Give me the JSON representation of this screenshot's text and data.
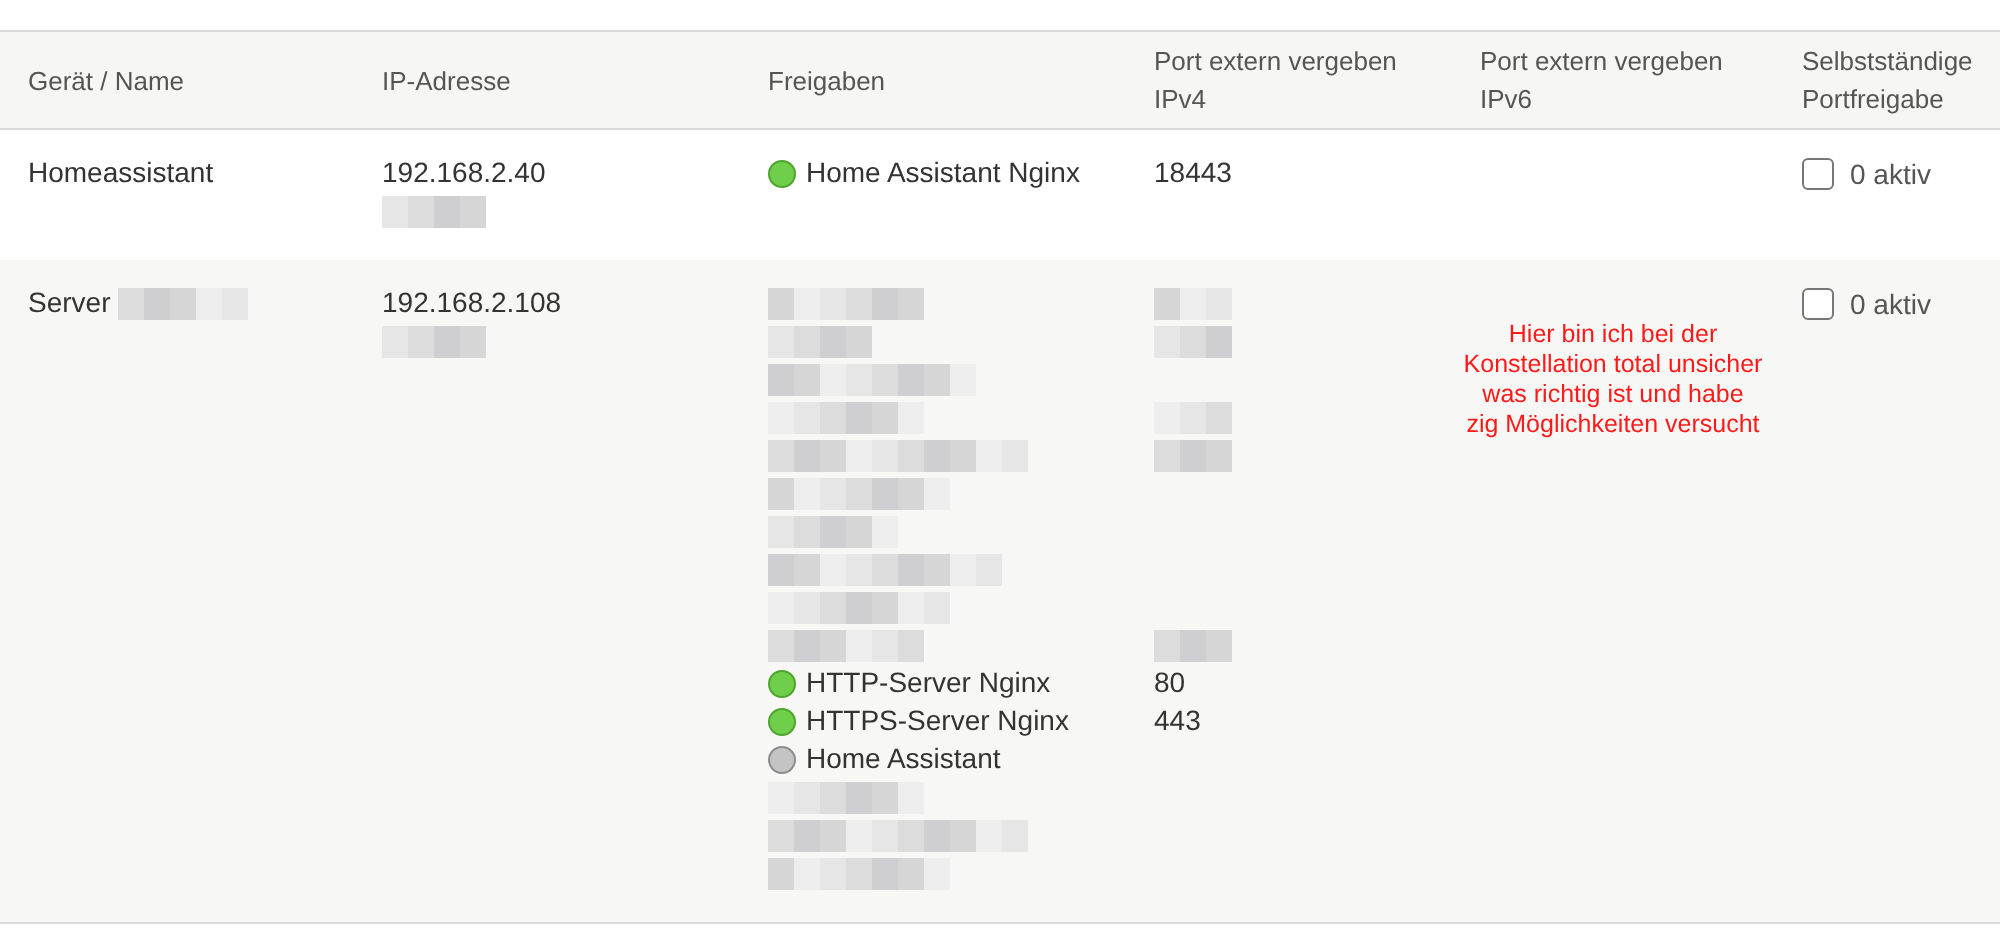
{
  "table": {
    "columns": [
      "Gerät / Name",
      "IP-Adresse",
      "Freigaben",
      "Port extern vergeben IPv4",
      "Port extern vergeben IPv6",
      "Selbstständige Portfreigabe"
    ],
    "rows": [
      {
        "name": [
          {
            "kind": "text",
            "text": "Homeassistant"
          }
        ],
        "ip": [
          {
            "kind": "text",
            "text": "192.168.2.40"
          },
          {
            "kind": "redacted"
          }
        ],
        "shares": [
          {
            "kind": "status",
            "text": "Home Assistant Nginx",
            "active": true
          }
        ],
        "ipv4": [
          {
            "kind": "text",
            "text": "18443"
          }
        ],
        "self_share": {
          "checked": false,
          "label": "0 aktiv"
        }
      },
      {
        "name": [
          {
            "kind": "text",
            "text": "Server"
          },
          {
            "kind": "redacted"
          }
        ],
        "ip": [
          {
            "kind": "text",
            "text": "192.168.2.108"
          },
          {
            "kind": "redacted"
          }
        ],
        "shares": [
          {
            "kind": "redacted"
          },
          {
            "kind": "redacted"
          },
          {
            "kind": "redacted"
          },
          {
            "kind": "redacted"
          },
          {
            "kind": "redacted"
          },
          {
            "kind": "redacted"
          },
          {
            "kind": "redacted"
          },
          {
            "kind": "redacted"
          },
          {
            "kind": "redacted"
          },
          {
            "kind": "redacted"
          },
          {
            "kind": "status",
            "text": "HTTP-Server Nginx",
            "active": true
          },
          {
            "kind": "status",
            "text": "HTTPS-Server Nginx",
            "active": true
          },
          {
            "kind": "status",
            "text": "Home Assistant",
            "active": false
          },
          {
            "kind": "redacted"
          },
          {
            "kind": "redacted"
          },
          {
            "kind": "redacted"
          }
        ],
        "ipv4": [
          {
            "kind": "redacted"
          },
          {
            "kind": "redacted"
          },
          {
            "kind": "blank"
          },
          {
            "kind": "redacted"
          },
          {
            "kind": "redacted"
          },
          {
            "kind": "blank"
          },
          {
            "kind": "blank"
          },
          {
            "kind": "blank"
          },
          {
            "kind": "blank"
          },
          {
            "kind": "redacted"
          },
          {
            "kind": "text",
            "text": "80"
          },
          {
            "kind": "text",
            "text": "443"
          }
        ],
        "note": "Hier bin ich bei der Konstellation total unsicher was richtig ist und habe zig Möglichkeiten versucht",
        "self_share": {
          "checked": false,
          "label": "0 aktiv"
        }
      }
    ]
  }
}
